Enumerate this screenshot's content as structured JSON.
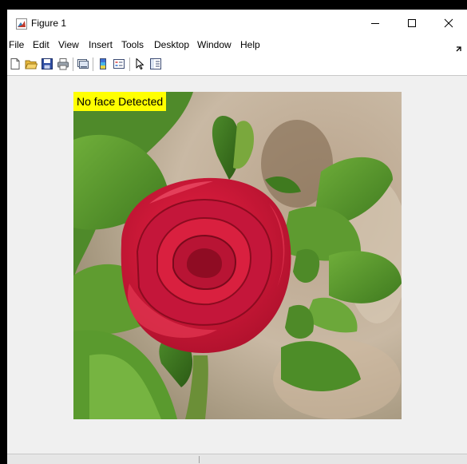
{
  "window": {
    "title": "Figure 1",
    "minimize_glyph": "—",
    "close_glyph": "✕"
  },
  "menu": {
    "items": [
      {
        "label": "File"
      },
      {
        "label": "Edit"
      },
      {
        "label": "View"
      },
      {
        "label": "Insert"
      },
      {
        "label": "Tools"
      },
      {
        "label": "Desktop"
      },
      {
        "label": "Window"
      },
      {
        "label": "Help"
      }
    ]
  },
  "toolbar": {
    "icons": [
      "new-figure-icon",
      "open-file-icon",
      "save-icon",
      "print-icon",
      "link-plot-icon",
      "colorbar-icon",
      "legend-icon",
      "pointer-icon",
      "plot-tools-icon"
    ]
  },
  "figure": {
    "label": "No face Detected",
    "label_background": "#ffff00",
    "image_subject": "rose-image"
  },
  "colors": {
    "title_bar": "#ffffff",
    "figure_background": "#f0f0f0",
    "rose": "#d81e3c"
  }
}
